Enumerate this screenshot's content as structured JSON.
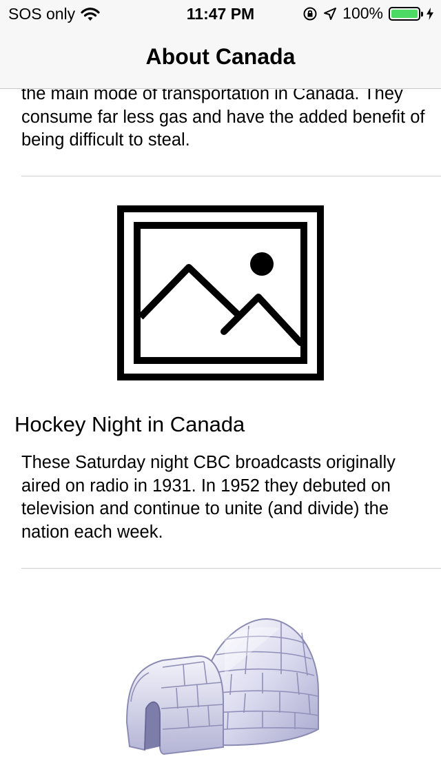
{
  "status_bar": {
    "carrier": "SOS only",
    "time": "11:47 PM",
    "battery_percent": "100%",
    "battery_color": "#4cd964"
  },
  "nav": {
    "title": "About Canada"
  },
  "items": [
    {
      "description": "the main mode of transportation in Canada. They consume far less gas and have the added benefit of being difficult to steal."
    },
    {
      "image_icon": "picture-placeholder-icon",
      "title": "Hockey Night in Canada",
      "description": "These Saturday night CBC broadcasts originally aired on radio in 1931. In 1952 they debuted on television and continue to unite (and divide) the nation each week."
    },
    {
      "image_icon": "igloo-icon"
    }
  ]
}
